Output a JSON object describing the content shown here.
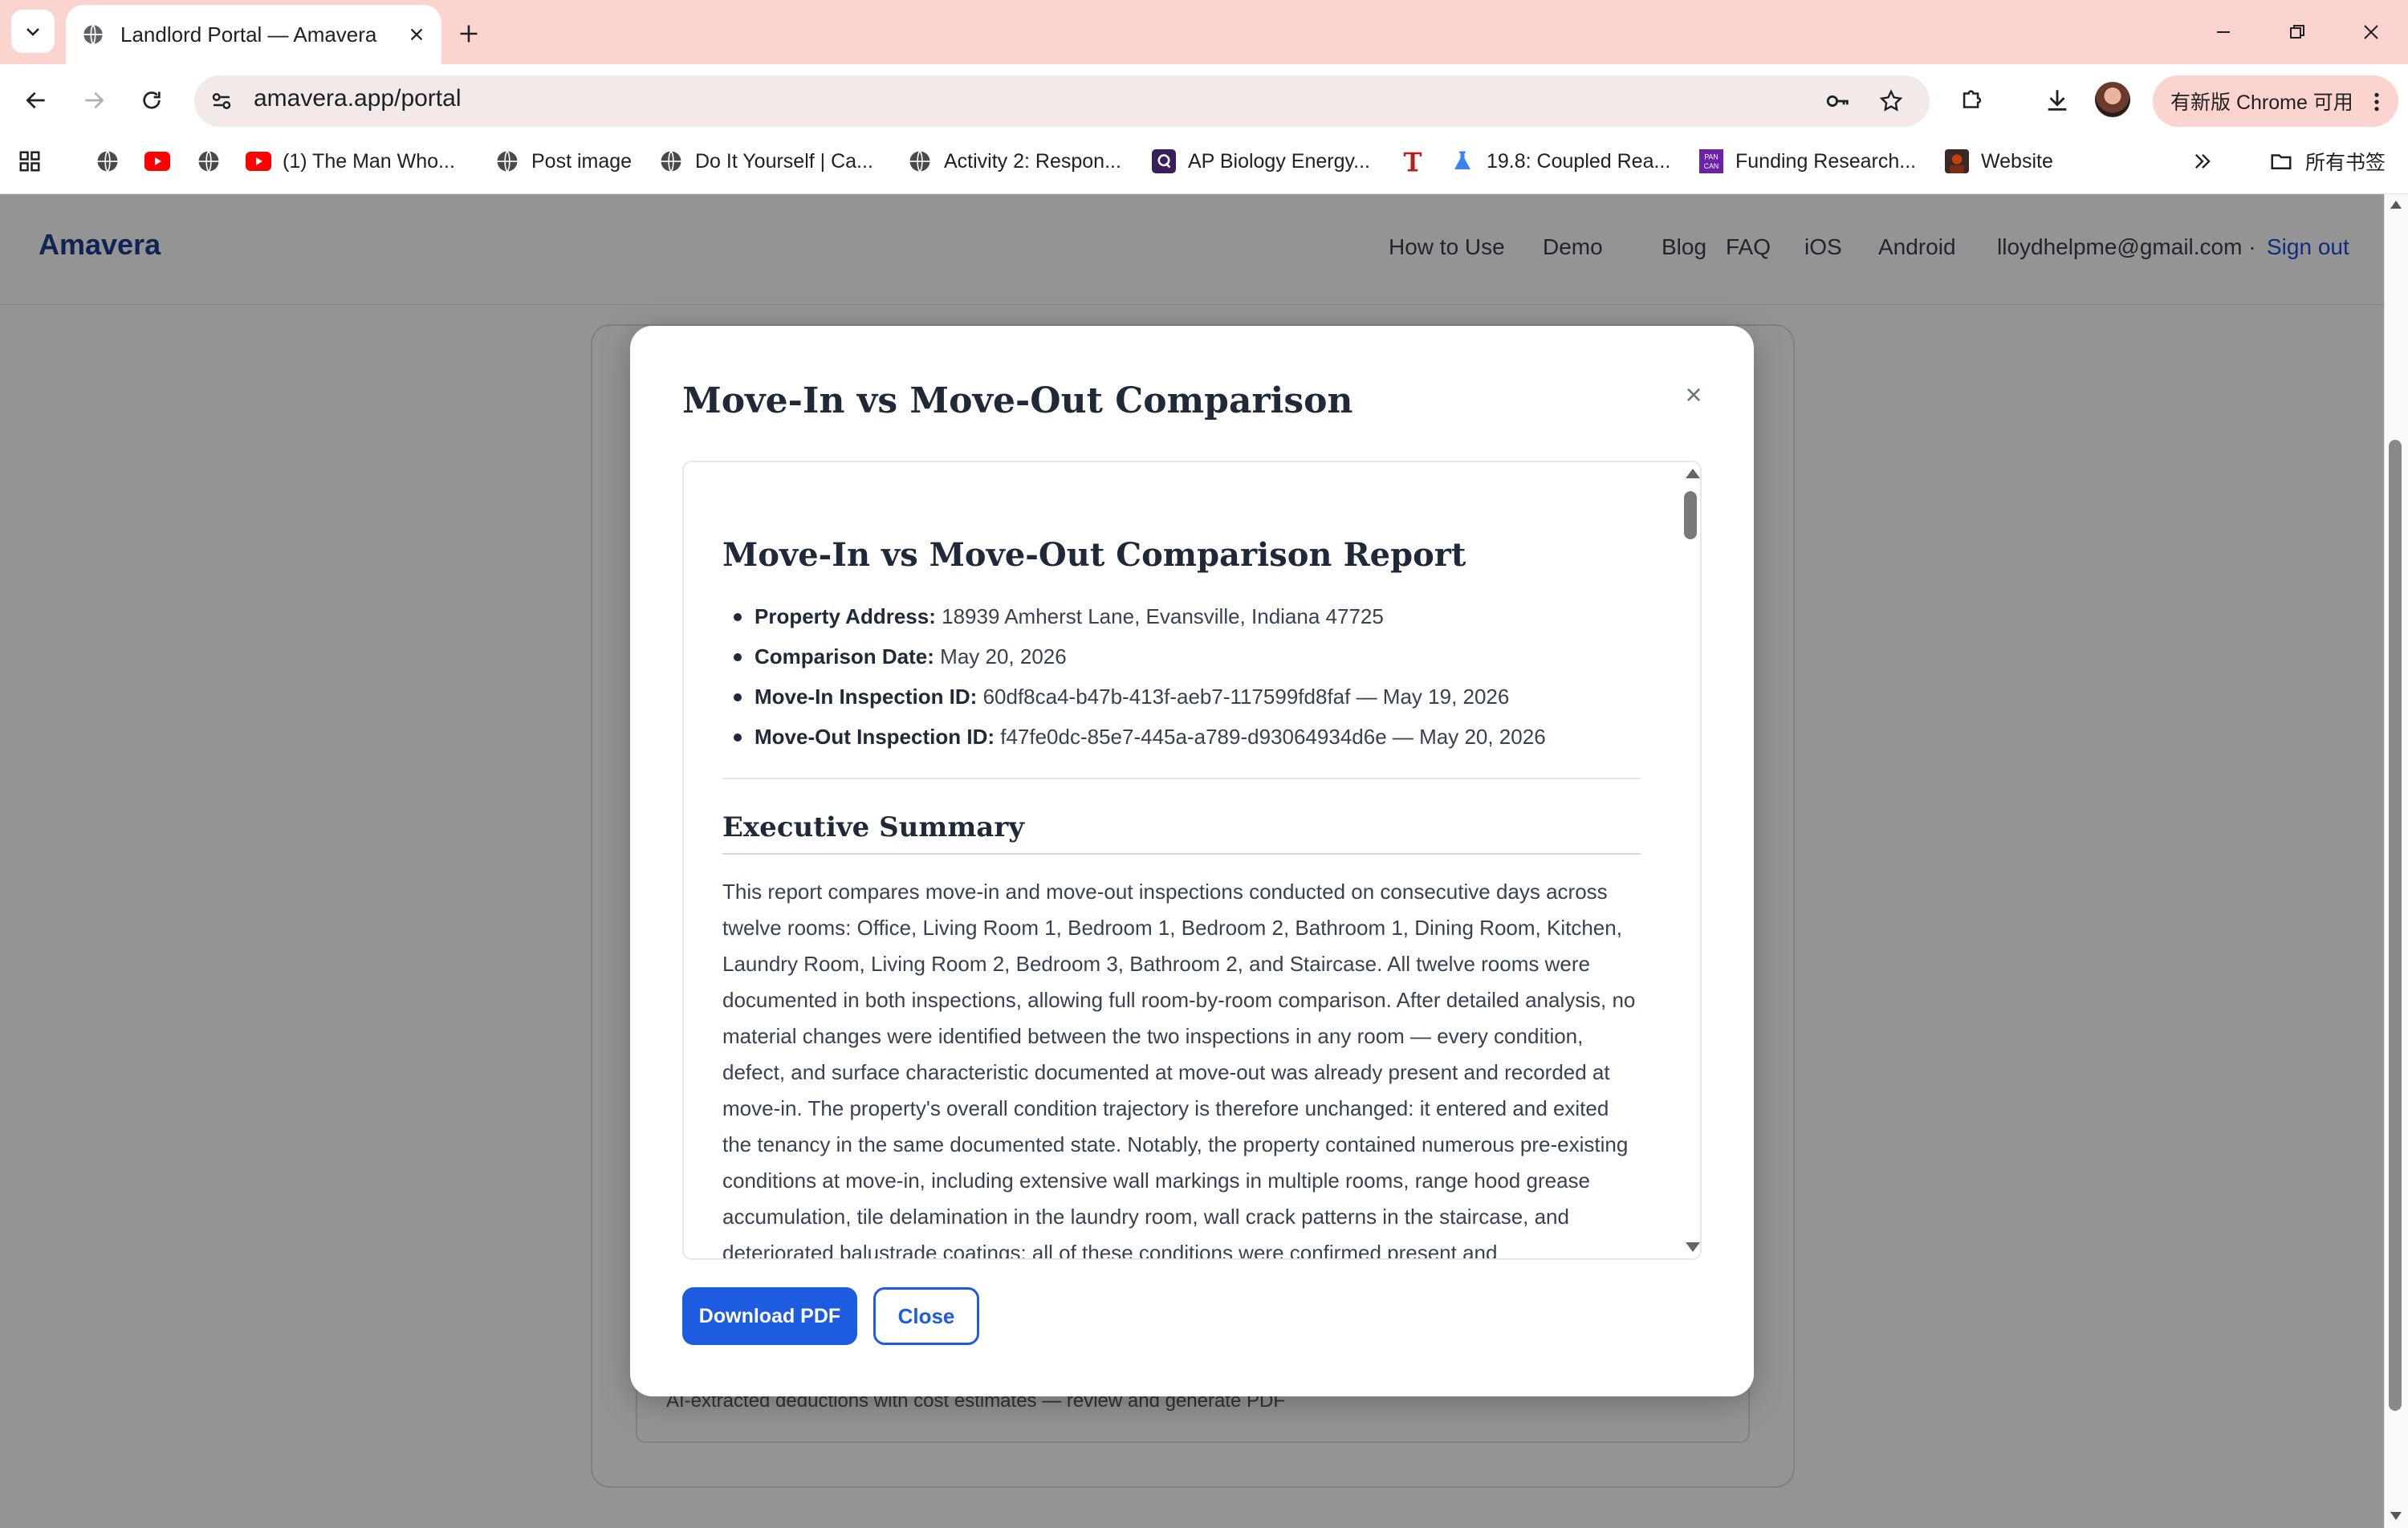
{
  "browser": {
    "tab_title": "Landlord Portal — Amavera",
    "url": "amavera.app/portal",
    "update_chip": "有新版 Chrome 可用",
    "bookmarks": [
      {
        "label": "",
        "icon": "globe-icon"
      },
      {
        "label": "",
        "icon": "youtube-icon"
      },
      {
        "label": "",
        "icon": "globe-icon"
      },
      {
        "label": "(1) The Man Who...",
        "icon": "youtube-icon"
      },
      {
        "label": "Post image",
        "icon": "globe-icon"
      },
      {
        "label": "Do It Yourself | Ca...",
        "icon": "globe-icon"
      },
      {
        "label": "Activity 2: Respon...",
        "icon": "globe-icon"
      },
      {
        "label": "AP Biology Energy...",
        "icon": "q-logo-icon"
      },
      {
        "label": "",
        "icon": "t-logo-icon"
      },
      {
        "label": "19.8: Coupled Rea...",
        "icon": "flask-icon"
      },
      {
        "label": "Funding Research...",
        "icon": "pancan-icon"
      },
      {
        "label": "Website",
        "icon": "avatar-icon"
      }
    ],
    "all_bookmarks": "所有书签"
  },
  "app": {
    "brand": "Amavera",
    "nav": [
      "How to Use",
      "Demo",
      "Blog",
      "FAQ",
      "iOS",
      "Android"
    ],
    "user_email": "lloydhelpme@gmail.com ·",
    "sign_out": "Sign out",
    "background_text": "AI-extracted deductions with cost estimates — review and generate PDF"
  },
  "modal": {
    "title": "Move-In vs Move-Out Comparison",
    "close_symbol": "×",
    "report": {
      "title": "Move-In vs Move-Out Comparison Report",
      "meta": [
        {
          "label": "Property Address:",
          "value": "18939 Amherst Lane, Evansville, Indiana 47725"
        },
        {
          "label": "Comparison Date:",
          "value": "May 20, 2026"
        },
        {
          "label": "Move-In Inspection ID:",
          "value": "60df8ca4-b47b-413f-aeb7-117599fd8faf — May 19, 2026"
        },
        {
          "label": "Move-Out Inspection ID:",
          "value": "f47fe0dc-85e7-445a-a789-d93064934d6e — May 20, 2026"
        }
      ],
      "section_title": "Executive Summary",
      "summary": "This report compares move-in and move-out inspections conducted on consecutive days across twelve rooms: Office, Living Room 1, Bedroom 1, Bedroom 2, Bathroom 1, Dining Room, Kitchen, Laundry Room, Living Room 2, Bedroom 3, Bathroom 2, and Staircase. All twelve rooms were documented in both inspections, allowing full room-by-room comparison. After detailed analysis, no material changes were identified between the two inspections in any room — every condition, defect, and surface characteristic documented at move-out was already present and recorded at move-in. The property's overall condition trajectory is therefore unchanged: it entered and exited the tenancy in the same documented state. Notably, the property contained numerous pre-existing conditions at move-in, including extensive wall markings in multiple rooms, range hood grease accumulation, tile delamination in the laundry room, wall crack patterns in the staircase, and deteriorated balustrade coatings; all of these conditions were confirmed present and"
    },
    "download_label": "Download PDF",
    "close_label": "Close"
  }
}
